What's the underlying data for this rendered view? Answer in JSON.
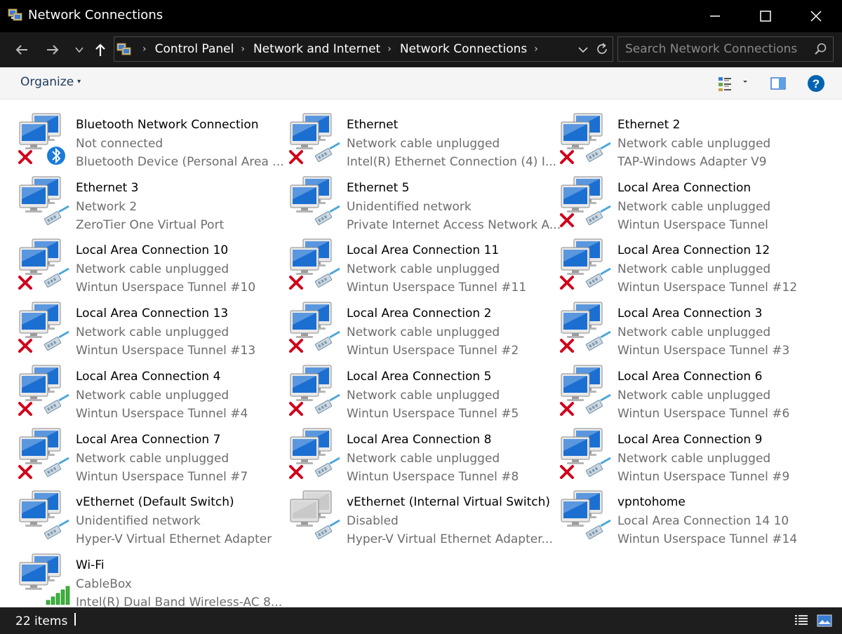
{
  "window": {
    "title": "Network Connections"
  },
  "address": {
    "breadcrumbs": [
      "Control Panel",
      "Network and Internet",
      "Network Connections"
    ]
  },
  "search": {
    "placeholder": "Search Network Connections"
  },
  "toolbar": {
    "organize_label": "Organize",
    "organize_caret": "▾"
  },
  "connections": [
    {
      "name": "Bluetooth Network Connection",
      "status": "Not connected",
      "device": "Bluetooth Device (Personal Area ...",
      "state": "disconnected",
      "badge": "bluetooth"
    },
    {
      "name": "Ethernet",
      "status": "Network cable unplugged",
      "device": "Intel(R) Ethernet Connection (4) I...",
      "state": "disconnected",
      "badge": "cable"
    },
    {
      "name": "Ethernet 2",
      "status": "Network cable unplugged",
      "device": "TAP-Windows Adapter V9",
      "state": "disconnected",
      "badge": "cable"
    },
    {
      "name": "Ethernet 3",
      "status": "Network  2",
      "device": "ZeroTier One Virtual Port",
      "state": "connected",
      "badge": "cable"
    },
    {
      "name": "Ethernet 5",
      "status": "Unidentified network",
      "device": "Private Internet Access Network A...",
      "state": "connected",
      "badge": "cable"
    },
    {
      "name": "Local Area Connection",
      "status": "Network cable unplugged",
      "device": "Wintun Userspace Tunnel",
      "state": "disconnected",
      "badge": "cable"
    },
    {
      "name": "Local Area Connection 10",
      "status": "Network cable unplugged",
      "device": "Wintun Userspace Tunnel #10",
      "state": "disconnected",
      "badge": "cable"
    },
    {
      "name": "Local Area Connection 11",
      "status": "Network cable unplugged",
      "device": "Wintun Userspace Tunnel #11",
      "state": "disconnected",
      "badge": "cable"
    },
    {
      "name": "Local Area Connection 12",
      "status": "Network cable unplugged",
      "device": "Wintun Userspace Tunnel #12",
      "state": "disconnected",
      "badge": "cable"
    },
    {
      "name": "Local Area Connection 13",
      "status": "Network cable unplugged",
      "device": "Wintun Userspace Tunnel #13",
      "state": "disconnected",
      "badge": "cable"
    },
    {
      "name": "Local Area Connection 2",
      "status": "Network cable unplugged",
      "device": "Wintun Userspace Tunnel #2",
      "state": "disconnected",
      "badge": "cable"
    },
    {
      "name": "Local Area Connection 3",
      "status": "Network cable unplugged",
      "device": "Wintun Userspace Tunnel #3",
      "state": "disconnected",
      "badge": "cable"
    },
    {
      "name": "Local Area Connection 4",
      "status": "Network cable unplugged",
      "device": "Wintun Userspace Tunnel #4",
      "state": "disconnected",
      "badge": "cable"
    },
    {
      "name": "Local Area Connection 5",
      "status": "Network cable unplugged",
      "device": "Wintun Userspace Tunnel #5",
      "state": "disconnected",
      "badge": "cable"
    },
    {
      "name": "Local Area Connection 6",
      "status": "Network cable unplugged",
      "device": "Wintun Userspace Tunnel #6",
      "state": "disconnected",
      "badge": "cable"
    },
    {
      "name": "Local Area Connection 7",
      "status": "Network cable unplugged",
      "device": "Wintun Userspace Tunnel #7",
      "state": "disconnected",
      "badge": "cable"
    },
    {
      "name": "Local Area Connection 8",
      "status": "Network cable unplugged",
      "device": "Wintun Userspace Tunnel #8",
      "state": "disconnected",
      "badge": "cable"
    },
    {
      "name": "Local Area Connection 9",
      "status": "Network cable unplugged",
      "device": "Wintun Userspace Tunnel #9",
      "state": "disconnected",
      "badge": "cable"
    },
    {
      "name": "vEthernet (Default Switch)",
      "status": "Unidentified network",
      "device": "Hyper-V Virtual Ethernet Adapter",
      "state": "connected",
      "badge": "cable"
    },
    {
      "name": "vEthernet (Internal Virtual Switch)",
      "status": "Disabled",
      "device": "Hyper-V Virtual Ethernet Adapter...",
      "state": "disabled",
      "badge": "cable"
    },
    {
      "name": "vpntohome",
      "status": "Local Area Connection 14 10",
      "device": "Wintun Userspace Tunnel #14",
      "state": "connected",
      "badge": "cable"
    },
    {
      "name": "Wi-Fi",
      "status": "CableBox",
      "device": "Intel(R) Dual Band Wireless-AC 8...",
      "state": "connected",
      "badge": "wifi"
    }
  ],
  "statusbar": {
    "item_count": "22 items"
  },
  "colors": {
    "titlebar": "#000000",
    "navbar": "#1a1a1a",
    "content_bg": "#ffffff",
    "status_text": "#6d6d6d",
    "error_red": "#d0021b",
    "help_blue": "#0063b1"
  }
}
